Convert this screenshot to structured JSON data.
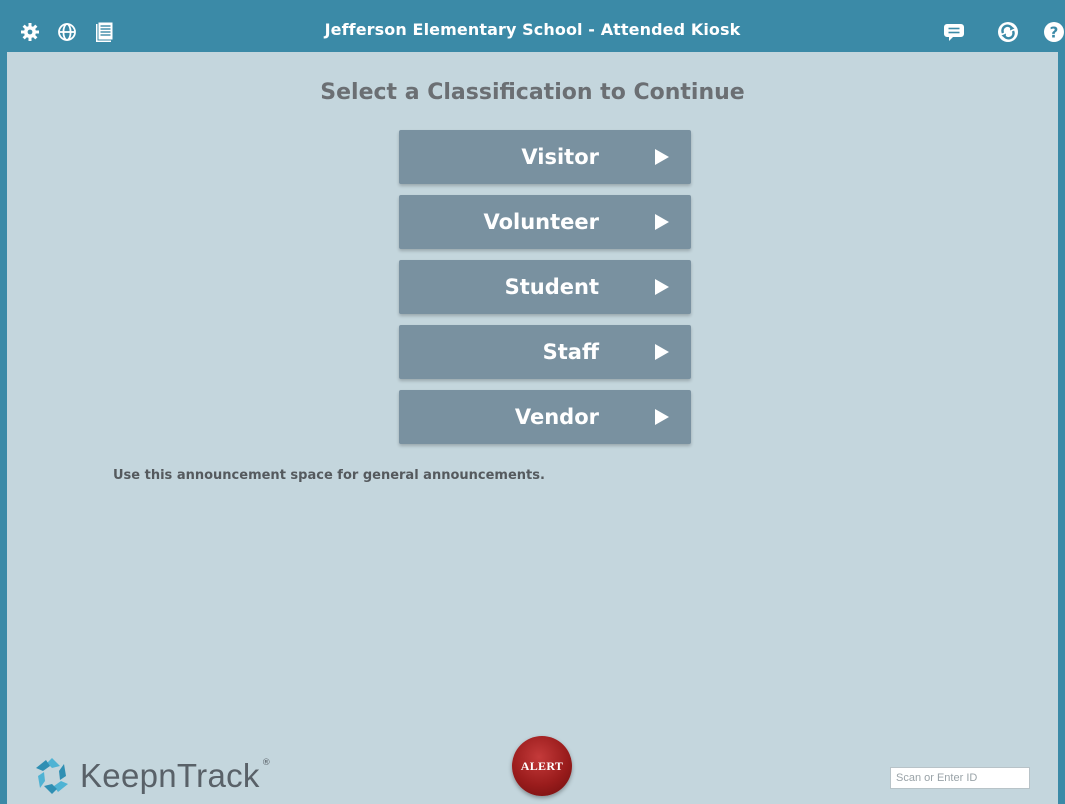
{
  "header": {
    "title": "Jefferson Elementary School - Attended Kiosk",
    "left_icons": [
      "gear-icon",
      "globe-icon",
      "document-icon"
    ],
    "right_icons": [
      "chat-icon",
      "refresh-icon",
      "help-icon"
    ]
  },
  "main": {
    "heading": "Select a Classification to Continue",
    "classifications": [
      {
        "label": "Visitor"
      },
      {
        "label": "Volunteer"
      },
      {
        "label": "Student"
      },
      {
        "label": "Staff"
      },
      {
        "label": "Vendor"
      }
    ],
    "announcement": "Use this announcement space for general announcements."
  },
  "footer": {
    "logo_text": "KeepnTrack",
    "logo_mark": "®",
    "alert_label": "ALERT",
    "id_input_placeholder": "Scan or Enter ID",
    "id_input_value": ""
  },
  "colors": {
    "header_bg": "#3b8aa7",
    "page_bg": "#c4d6dd",
    "button_bg": "#7991a0",
    "alert_red": "#9a1c1c"
  }
}
